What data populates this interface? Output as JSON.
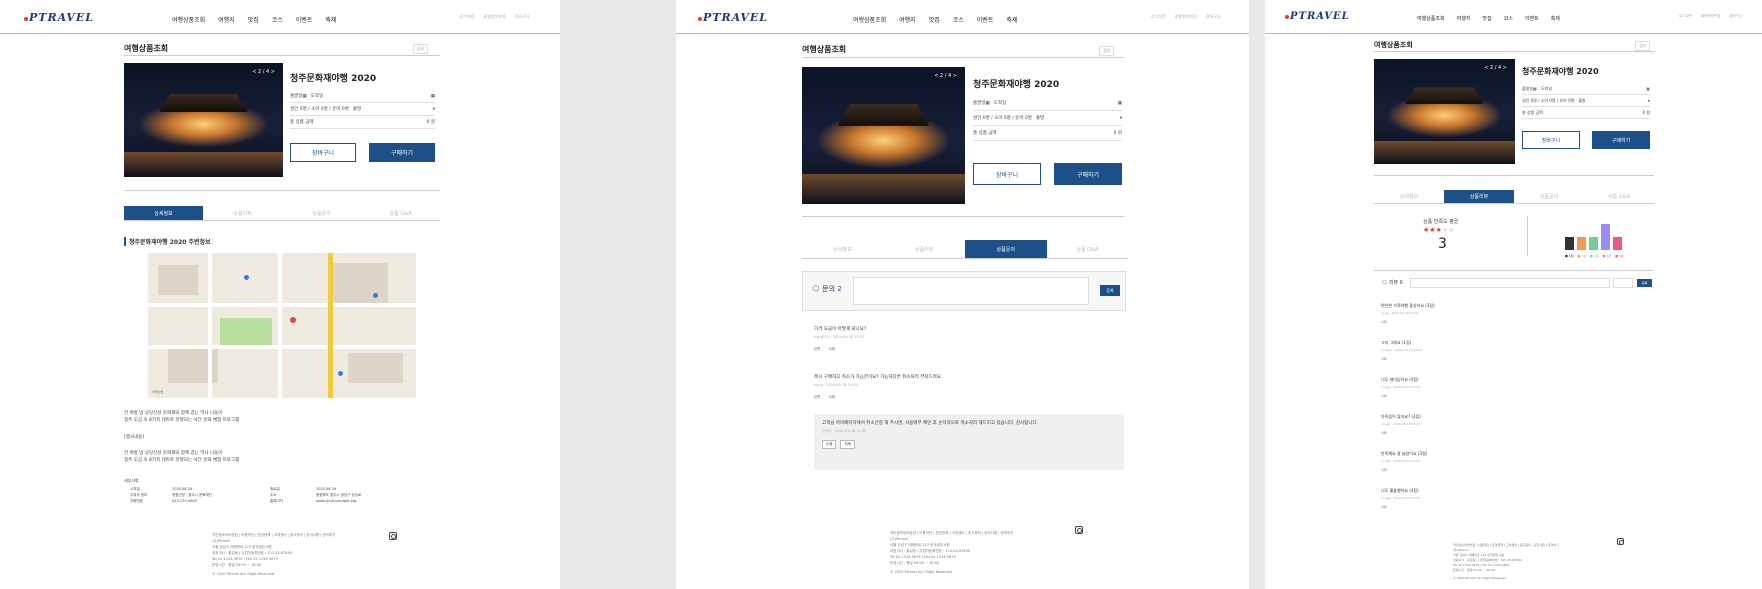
{
  "header": {
    "logo": "PTRAVEL",
    "nav": [
      "여행상품조회",
      "여행지",
      "맛집",
      "코스",
      "이벤트",
      "축제"
    ],
    "util": [
      "로그아웃",
      "회원정보변경",
      "장바구니"
    ]
  },
  "product": {
    "section_title": "여행상품조회",
    "share_label": "공유",
    "title": "청주문화재야행 2020",
    "image_counter": "< 2 / 4 >",
    "form": {
      "start_label": "출발일",
      "end_label": "도착일",
      "people_options": "성인 0명 / 소아 0명 / 유아 0명",
      "departure_label": "출발",
      "total_label": "총 상품 금액",
      "total_value": "0 원"
    },
    "cart_button": "장바구니",
    "buy_button": "구매하기"
  },
  "tabs": [
    "상세정보",
    "상품리뷰",
    "상품문의",
    "상품 Q&A"
  ],
  "detail": {
    "subtitle": "청주문화재야행 2020 주변정보",
    "map_badge": "카카오맵",
    "desc1": "한 여름 밤 상당산성 문화재와 함께 걷는 역사 나들이",
    "desc2": "청주 도심 속 8가지 테마로 진행되는 야간 문화 체험 프로그램",
    "label_intro": "[행사내용]",
    "desc3": "한 여름 밤 상당산성 문화재와 함께 걷는 역사 나들이",
    "desc4": "청주 도심 속 8가지 테마로 진행되는 야간 문화 체험 프로그램",
    "info_title": "세부사항",
    "info_rows": [
      [
        "시작일",
        "2020.08.28",
        "종료일",
        "2020.08.29"
      ],
      [
        "주최자 정보",
        "청원군청 · 청주시 문화재단",
        "주소",
        "충청북도 청주시 상당구 상당로"
      ],
      [
        "전화번호",
        "043-270-0000",
        "홈페이지",
        "www.cjculturenight.org"
      ]
    ]
  },
  "footer": {
    "links": "개인정보처리방침 | 이용약관 | 운영정책 | 고객센터 | 광고문의 | 공지사항 | 문의하기",
    "company": "(주)Ptravel",
    "address": "서울 강남구 테헤란로 123 한국빌딩 6층",
    "ceo": "대표이사 : 홍길동 | 사업자등록번호 : 123-45-67890",
    "tel": "Tel 02-1234-5678 | Fax 02-1234-5679",
    "hours": "운영시간 : 평일 09:00 ~ 18:00",
    "copyright": "© 2020 Ptravel ALL Right Reserved"
  },
  "qna": {
    "label": "문의",
    "count": "2",
    "register": "등록",
    "items": [
      {
        "text": "가격 요금이 어떻게 되나요?",
        "meta": "hong123 · 2020-09-18 10:23",
        "actions": [
          "답변",
          "삭제"
        ]
      },
      {
        "text": "혹시 구매하고 취소가 가능한가요? 가능하다면 취소처리 부탁드려요",
        "meta": "hong · 2020-09-18 10:45",
        "actions": [
          "답변",
          "삭제"
        ]
      }
    ],
    "answer": {
      "text": "고객님 마이페이지에서 취소신청 해 주시면, 사용여부 확인 후 순차적으로 취소처리 해드리고 있습니다. 감사합니다.",
      "meta": "관리자 · 2020-09-18 11:02",
      "actions": [
        "수정",
        "삭제"
      ]
    }
  },
  "review": {
    "score_label": "상품 만족도 평균",
    "score": "3",
    "review_label": "리뷰",
    "review_count": "6",
    "dist": [
      {
        "label": "1점",
        "value": 1,
        "color": "#333333"
      },
      {
        "label": "2점",
        "value": 1,
        "color": "#f2994a"
      },
      {
        "label": "3점",
        "value": 1,
        "color": "#6fcf97"
      },
      {
        "label": "4점",
        "value": 2,
        "color": "#9b8bf4"
      },
      {
        "label": "5점",
        "value": 1,
        "color": "#eb5780"
      }
    ],
    "items": [
      {
        "text": "편안한 가족여행 좋았어요 (3점)",
        "meta": "hong · 2020-09-18 10:00",
        "act": "삭제"
      },
      {
        "text": "그저 그래요 (1점)",
        "meta": "hong12 · 2020-09-18 10:05",
        "act": "삭제"
      },
      {
        "text": "너무 재미있어요 (4점)",
        "meta": "hong3 · 2020-09-18 10:12",
        "act": "삭제"
      },
      {
        "text": "아쉬움이 많아요? (2점)",
        "meta": "hong4 · 2020-09-18 10:20",
        "act": "삭제"
      },
      {
        "text": "만족해요 잘 놀았어요 (3점)",
        "meta": "hong5 · 2020-09-18 10:31",
        "act": "삭제"
      },
      {
        "text": "너무 훌륭했어요 (4점)",
        "meta": "hong6 · 2020-09-18 10:40",
        "act": "삭제"
      }
    ]
  }
}
